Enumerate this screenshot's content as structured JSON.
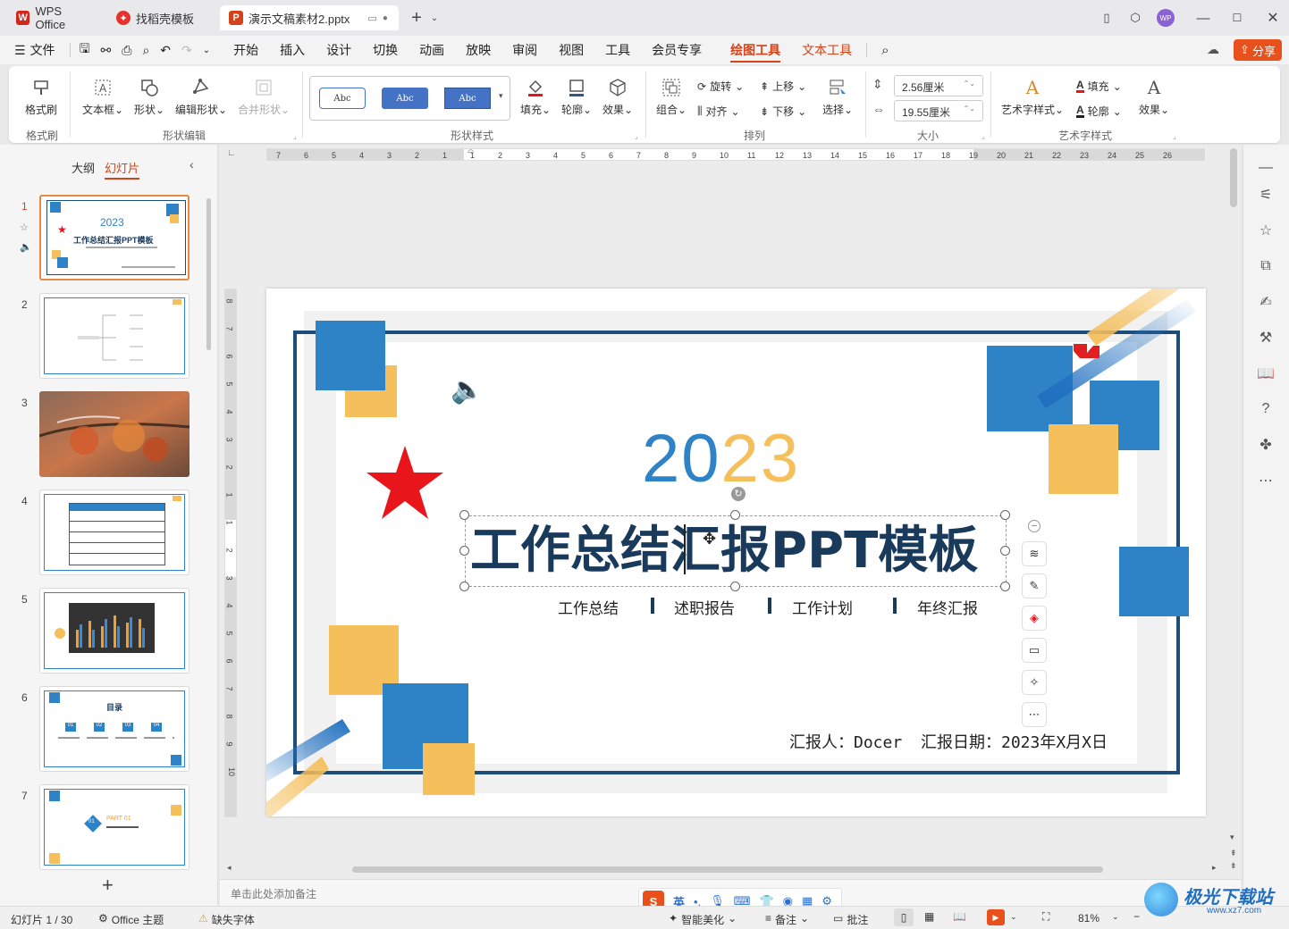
{
  "tabs": [
    {
      "label": "WPS Office",
      "logo": "W",
      "logo_color": "#d4271c"
    },
    {
      "label": "找稻壳模板",
      "logo": "稻",
      "logo_color": "#e5322d"
    },
    {
      "label": "演示文稿素材2.pptx",
      "logo": "P",
      "logo_color": "#d4431a"
    }
  ],
  "user_avatar": "WP",
  "menu": {
    "file": "文件",
    "items": [
      "开始",
      "插入",
      "设计",
      "切换",
      "动画",
      "放映",
      "审阅",
      "视图",
      "工具",
      "会员专享"
    ],
    "active": "绘图工具",
    "text_tools": "文本工具",
    "share": "分享"
  },
  "ribbon": {
    "format_painter": "格式刷",
    "format_group": "格式刷",
    "textbox": "文本框",
    "shape": "形状",
    "edit_shape": "编辑形状",
    "merge_shape": "合并形状",
    "shape_edit_group": "形状编辑",
    "style_samples": [
      "Abc",
      "Abc",
      "Abc"
    ],
    "fill": "填充",
    "outline": "轮廓",
    "effect": "效果",
    "shape_style_group": "形状样式",
    "group": "组合",
    "rotate": "旋转",
    "align": "对齐",
    "bring_up": "上移",
    "send_down": "下移",
    "select": "选择",
    "arrange_group": "排列",
    "height": "2.56厘米",
    "width": "19.55厘米",
    "size_group": "大小",
    "art_style": "艺术字样式",
    "text_fill": "填充",
    "text_outline": "轮廓",
    "text_effect": "效果",
    "art_group": "艺术字样式"
  },
  "leftpanel": {
    "outline_tab": "大纲",
    "slides_tab": "幻灯片",
    "slide_numbers": [
      "1",
      "2",
      "3",
      "4",
      "5",
      "6",
      "7"
    ],
    "thumb1_year": "2023",
    "thumb1_title": "工作总结汇报PPT模板",
    "thumb6_title": "目录",
    "thumb6_nums": [
      "01",
      "02",
      "03",
      "04"
    ],
    "thumb7_part": "PART 01",
    "thumb7_num": "01"
  },
  "ruler_top": [
    "7",
    "6",
    "5",
    "4",
    "3",
    "2",
    "1",
    "1",
    "2",
    "3",
    "4",
    "5",
    "6",
    "7",
    "8",
    "9",
    "10",
    "11",
    "12",
    "13",
    "14",
    "15",
    "16",
    "17",
    "18",
    "19",
    "20",
    "21",
    "22",
    "23",
    "24",
    "25",
    "26"
  ],
  "ruler_left": [
    "8",
    "7",
    "6",
    "5",
    "4",
    "3",
    "2",
    "1",
    "1",
    "2",
    "3",
    "4",
    "5",
    "6",
    "7",
    "8",
    "9",
    "10"
  ],
  "slide": {
    "year_part1": "20",
    "year_part2": "23",
    "title": "工作总结汇报PPT模板",
    "subtitles": [
      "工作总结",
      "述职报告",
      "工作计划",
      "年终汇报"
    ],
    "reporter": "汇报人：Docer",
    "date": "汇报日期：2023年X月X日",
    "colors": {
      "blue": "#2e82c6",
      "gold": "#f5bf5b",
      "navy": "#1a3a5c",
      "red": "#e8151b"
    }
  },
  "notes_placeholder": "单击此处添加备注",
  "ime": {
    "lang": "英"
  },
  "status": {
    "slide_info": "幻灯片 1 / 30",
    "theme": "Office 主题",
    "missing_font": "缺失字体",
    "beautify": "智能美化",
    "notes": "备注",
    "comments": "批注",
    "zoom": "81%"
  },
  "watermark": {
    "text": "极光下载站",
    "url": "www.xz7.com"
  }
}
